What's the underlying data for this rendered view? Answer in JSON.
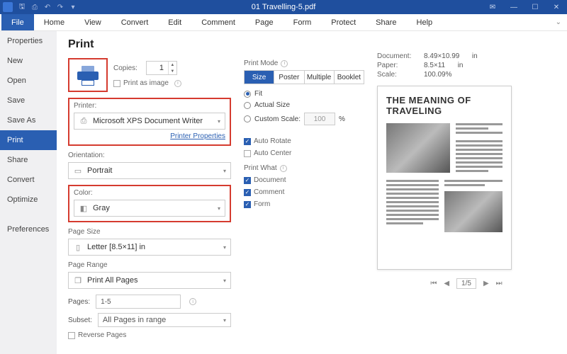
{
  "titlebar": {
    "title": "01 Travelling-5.pdf"
  },
  "menus": {
    "file": "File",
    "home": "Home",
    "view": "View",
    "convert": "Convert",
    "edit": "Edit",
    "comment": "Comment",
    "page": "Page",
    "form": "Form",
    "protect": "Protect",
    "share": "Share",
    "help": "Help"
  },
  "sidebar": {
    "items": [
      "Properties",
      "New",
      "Open",
      "Save",
      "Save As",
      "Print",
      "Share",
      "Convert",
      "Optimize"
    ],
    "preferences": "Preferences"
  },
  "print": {
    "title": "Print",
    "copies_label": "Copies:",
    "copies_value": "1",
    "print_as_image": "Print as image",
    "printer_label": "Printer:",
    "printer_value": "Microsoft XPS Document Writer",
    "printer_properties": "Printer Properties",
    "orientation_label": "Orientation:",
    "orientation_value": "Portrait",
    "color_label": "Color:",
    "color_value": "Gray",
    "pagesize_label": "Page Size",
    "pagesize_value": "Letter [8.5×11] in",
    "pagerange_label": "Page Range",
    "pagerange_value": "Print All Pages",
    "pages_label": "Pages:",
    "pages_value": "1-5",
    "subset_label": "Subset:",
    "subset_value": "All Pages in range",
    "reverse_pages": "Reverse Pages"
  },
  "mode": {
    "title": "Print Mode",
    "seg": {
      "size": "Size",
      "poster": "Poster",
      "multiple": "Multiple",
      "booklet": "Booklet"
    },
    "fit": "Fit",
    "actual": "Actual Size",
    "custom": "Custom Scale:",
    "custom_value": "100",
    "percent": "%",
    "autorotate": "Auto Rotate",
    "autocenter": "Auto Center",
    "printwhat": "Print What",
    "document": "Document",
    "comment": "Comment",
    "form": "Form"
  },
  "preview": {
    "doc_label": "Document:",
    "doc_value": "8.49×10.99",
    "paper_label": "Paper:",
    "paper_value": "8.5×11",
    "unit": "in",
    "scale_label": "Scale:",
    "scale_value": "100.09%",
    "headline": "THE MEANING OF TRAVELING",
    "page_current": "1",
    "page_total": "/5"
  }
}
